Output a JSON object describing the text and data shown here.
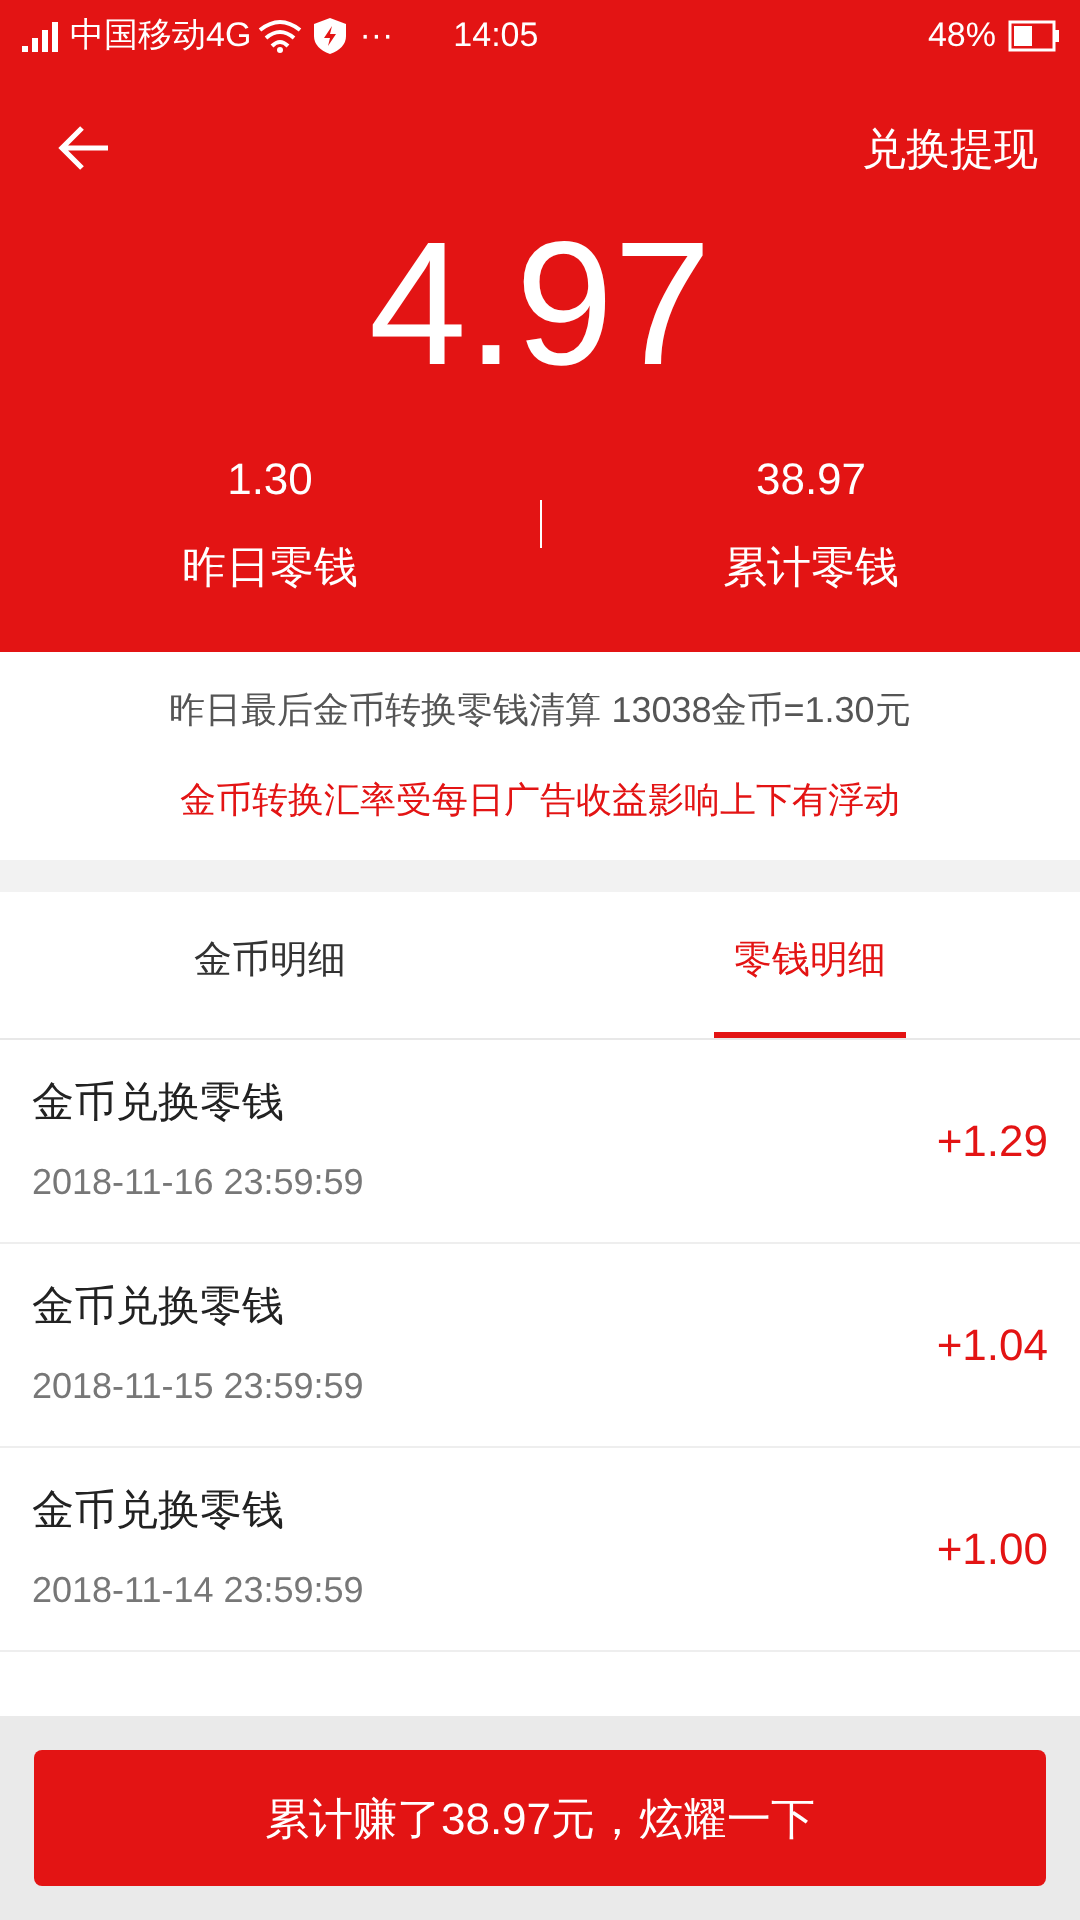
{
  "status_bar": {
    "carrier": "中国移动4G",
    "more": "···",
    "time": "14:05",
    "battery": "48%"
  },
  "header": {
    "title": "兑换提现",
    "balance": "4.97",
    "stats": [
      {
        "value": "1.30",
        "label": "昨日零钱"
      },
      {
        "value": "38.97",
        "label": "累计零钱"
      }
    ]
  },
  "notice": {
    "line": "昨日最后金币转换零钱清算 13038金币=1.30元",
    "warning": "金币转换汇率受每日广告收益影响上下有浮动"
  },
  "tabs": [
    {
      "label": "金币明细",
      "selected": false
    },
    {
      "label": "零钱明细",
      "selected": true
    }
  ],
  "records": [
    {
      "title": "金币兑换零钱",
      "time": "2018-11-16 23:59:59",
      "amount": "+1.29"
    },
    {
      "title": "金币兑换零钱",
      "time": "2018-11-15 23:59:59",
      "amount": "+1.04"
    },
    {
      "title": "金币兑换零钱",
      "time": "2018-11-14 23:59:59",
      "amount": "+1.00"
    }
  ],
  "share_button": "累计赚了38.97元，炫耀一下"
}
